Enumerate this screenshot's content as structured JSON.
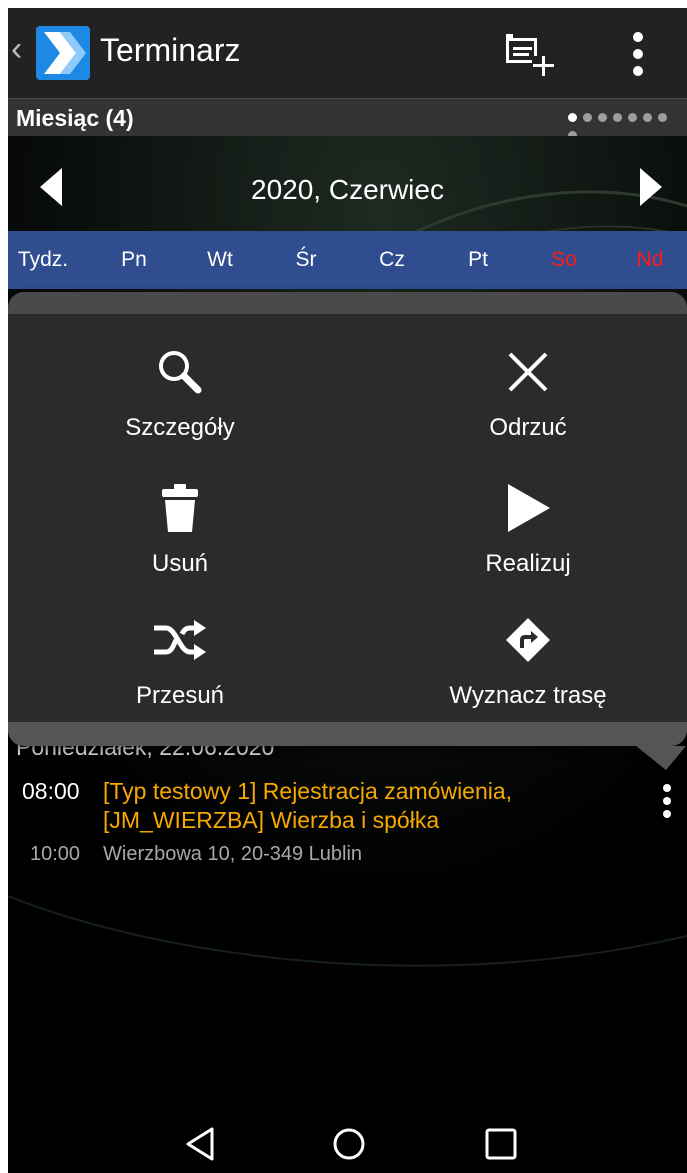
{
  "app": {
    "title": "Terminarz"
  },
  "view": {
    "title": "Miesiąc (4)",
    "pages": 8,
    "active_page": 1
  },
  "month": {
    "label": "2020, Czerwiec"
  },
  "weekdays": [
    {
      "label": "Tydz.",
      "weekend": false
    },
    {
      "label": "Pn",
      "weekend": false
    },
    {
      "label": "Wt",
      "weekend": false
    },
    {
      "label": "Śr",
      "weekend": false
    },
    {
      "label": "Cz",
      "weekend": false
    },
    {
      "label": "Pt",
      "weekend": false
    },
    {
      "label": "So",
      "weekend": true
    },
    {
      "label": "Nd",
      "weekend": true
    }
  ],
  "menu": {
    "details": "Szczegóły",
    "reject": "Odrzuć",
    "delete": "Usuń",
    "execute": "Realizuj",
    "move": "Przesuń",
    "route": "Wyznacz trasę"
  },
  "date_header": "Poniedziałek, 22.06.2020",
  "event": {
    "start_time": "08:00",
    "title_line1": "[Typ testowy 1] Rejestracja zamówienia,",
    "title_line2": "[JM_WIERZBA] Wierzba i spółka",
    "end_time": "10:00",
    "address": "Wierzbowa 10, 20-349 Lublin"
  },
  "colors": {
    "action_bar": "#222222",
    "week_header": "#2f4d8f",
    "weekend_text": "#ff1a1a",
    "event_title": "#f7a800",
    "popup_bg": "#2b2b2b"
  }
}
